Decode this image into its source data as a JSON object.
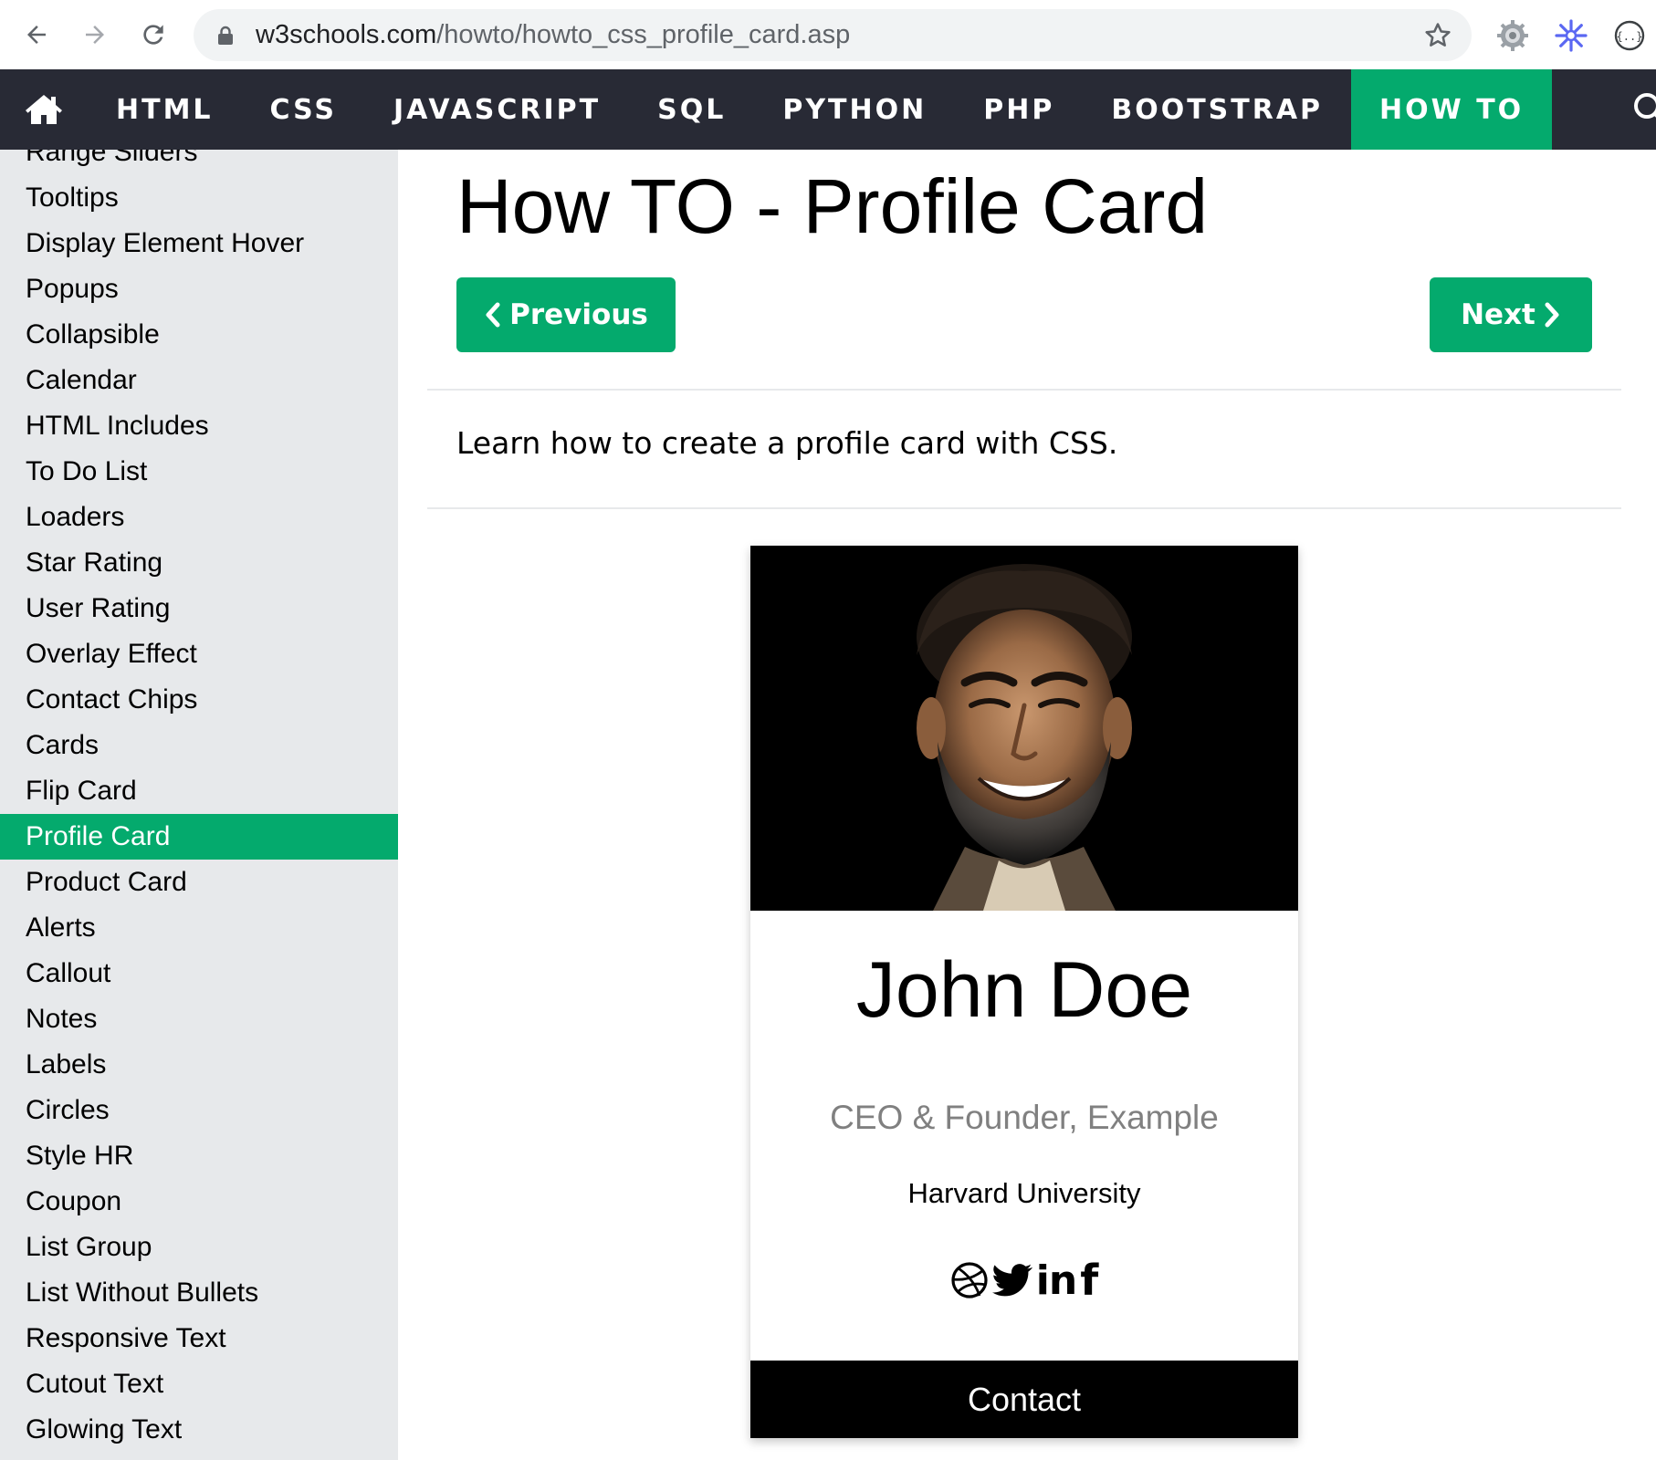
{
  "browser": {
    "url_domain": "w3schools.com",
    "url_path": "/howto/howto_css_profile_card.asp"
  },
  "topnav": {
    "items": [
      {
        "label": "HTML"
      },
      {
        "label": "CSS"
      },
      {
        "label": "JAVASCRIPT"
      },
      {
        "label": "SQL"
      },
      {
        "label": "PYTHON"
      },
      {
        "label": "PHP"
      },
      {
        "label": "BOOTSTRAP"
      },
      {
        "label": "HOW TO",
        "active": true
      }
    ]
  },
  "sidebar": {
    "items": [
      {
        "label": "Range Sliders"
      },
      {
        "label": "Tooltips"
      },
      {
        "label": "Display Element Hover"
      },
      {
        "label": "Popups"
      },
      {
        "label": "Collapsible"
      },
      {
        "label": "Calendar"
      },
      {
        "label": "HTML Includes"
      },
      {
        "label": "To Do List"
      },
      {
        "label": "Loaders"
      },
      {
        "label": "Star Rating"
      },
      {
        "label": "User Rating"
      },
      {
        "label": "Overlay Effect"
      },
      {
        "label": "Contact Chips"
      },
      {
        "label": "Cards"
      },
      {
        "label": "Flip Card"
      },
      {
        "label": "Profile Card",
        "active": true
      },
      {
        "label": "Product Card"
      },
      {
        "label": "Alerts"
      },
      {
        "label": "Callout"
      },
      {
        "label": "Notes"
      },
      {
        "label": "Labels"
      },
      {
        "label": "Circles"
      },
      {
        "label": "Style HR"
      },
      {
        "label": "Coupon"
      },
      {
        "label": "List Group"
      },
      {
        "label": "List Without Bullets"
      },
      {
        "label": "Responsive Text"
      },
      {
        "label": "Cutout Text"
      },
      {
        "label": "Glowing Text"
      }
    ]
  },
  "main": {
    "title": "How TO - Profile Card",
    "prev_label": "Previous",
    "next_label": "Next",
    "intro": "Learn how to create a profile card with CSS."
  },
  "card": {
    "name": "John Doe",
    "title": "CEO & Founder, Example",
    "school": "Harvard University",
    "linkedin_text": "in",
    "facebook_text": "f",
    "contact_label": "Contact",
    "social_icons": [
      "dribbble-icon",
      "twitter-icon",
      "linkedin-icon",
      "facebook-icon"
    ]
  },
  "colors": {
    "accent_green": "#04aa6d",
    "topnav_bg": "#282a35",
    "sidebar_bg": "#e7e9eb",
    "title_gray": "#808080"
  }
}
